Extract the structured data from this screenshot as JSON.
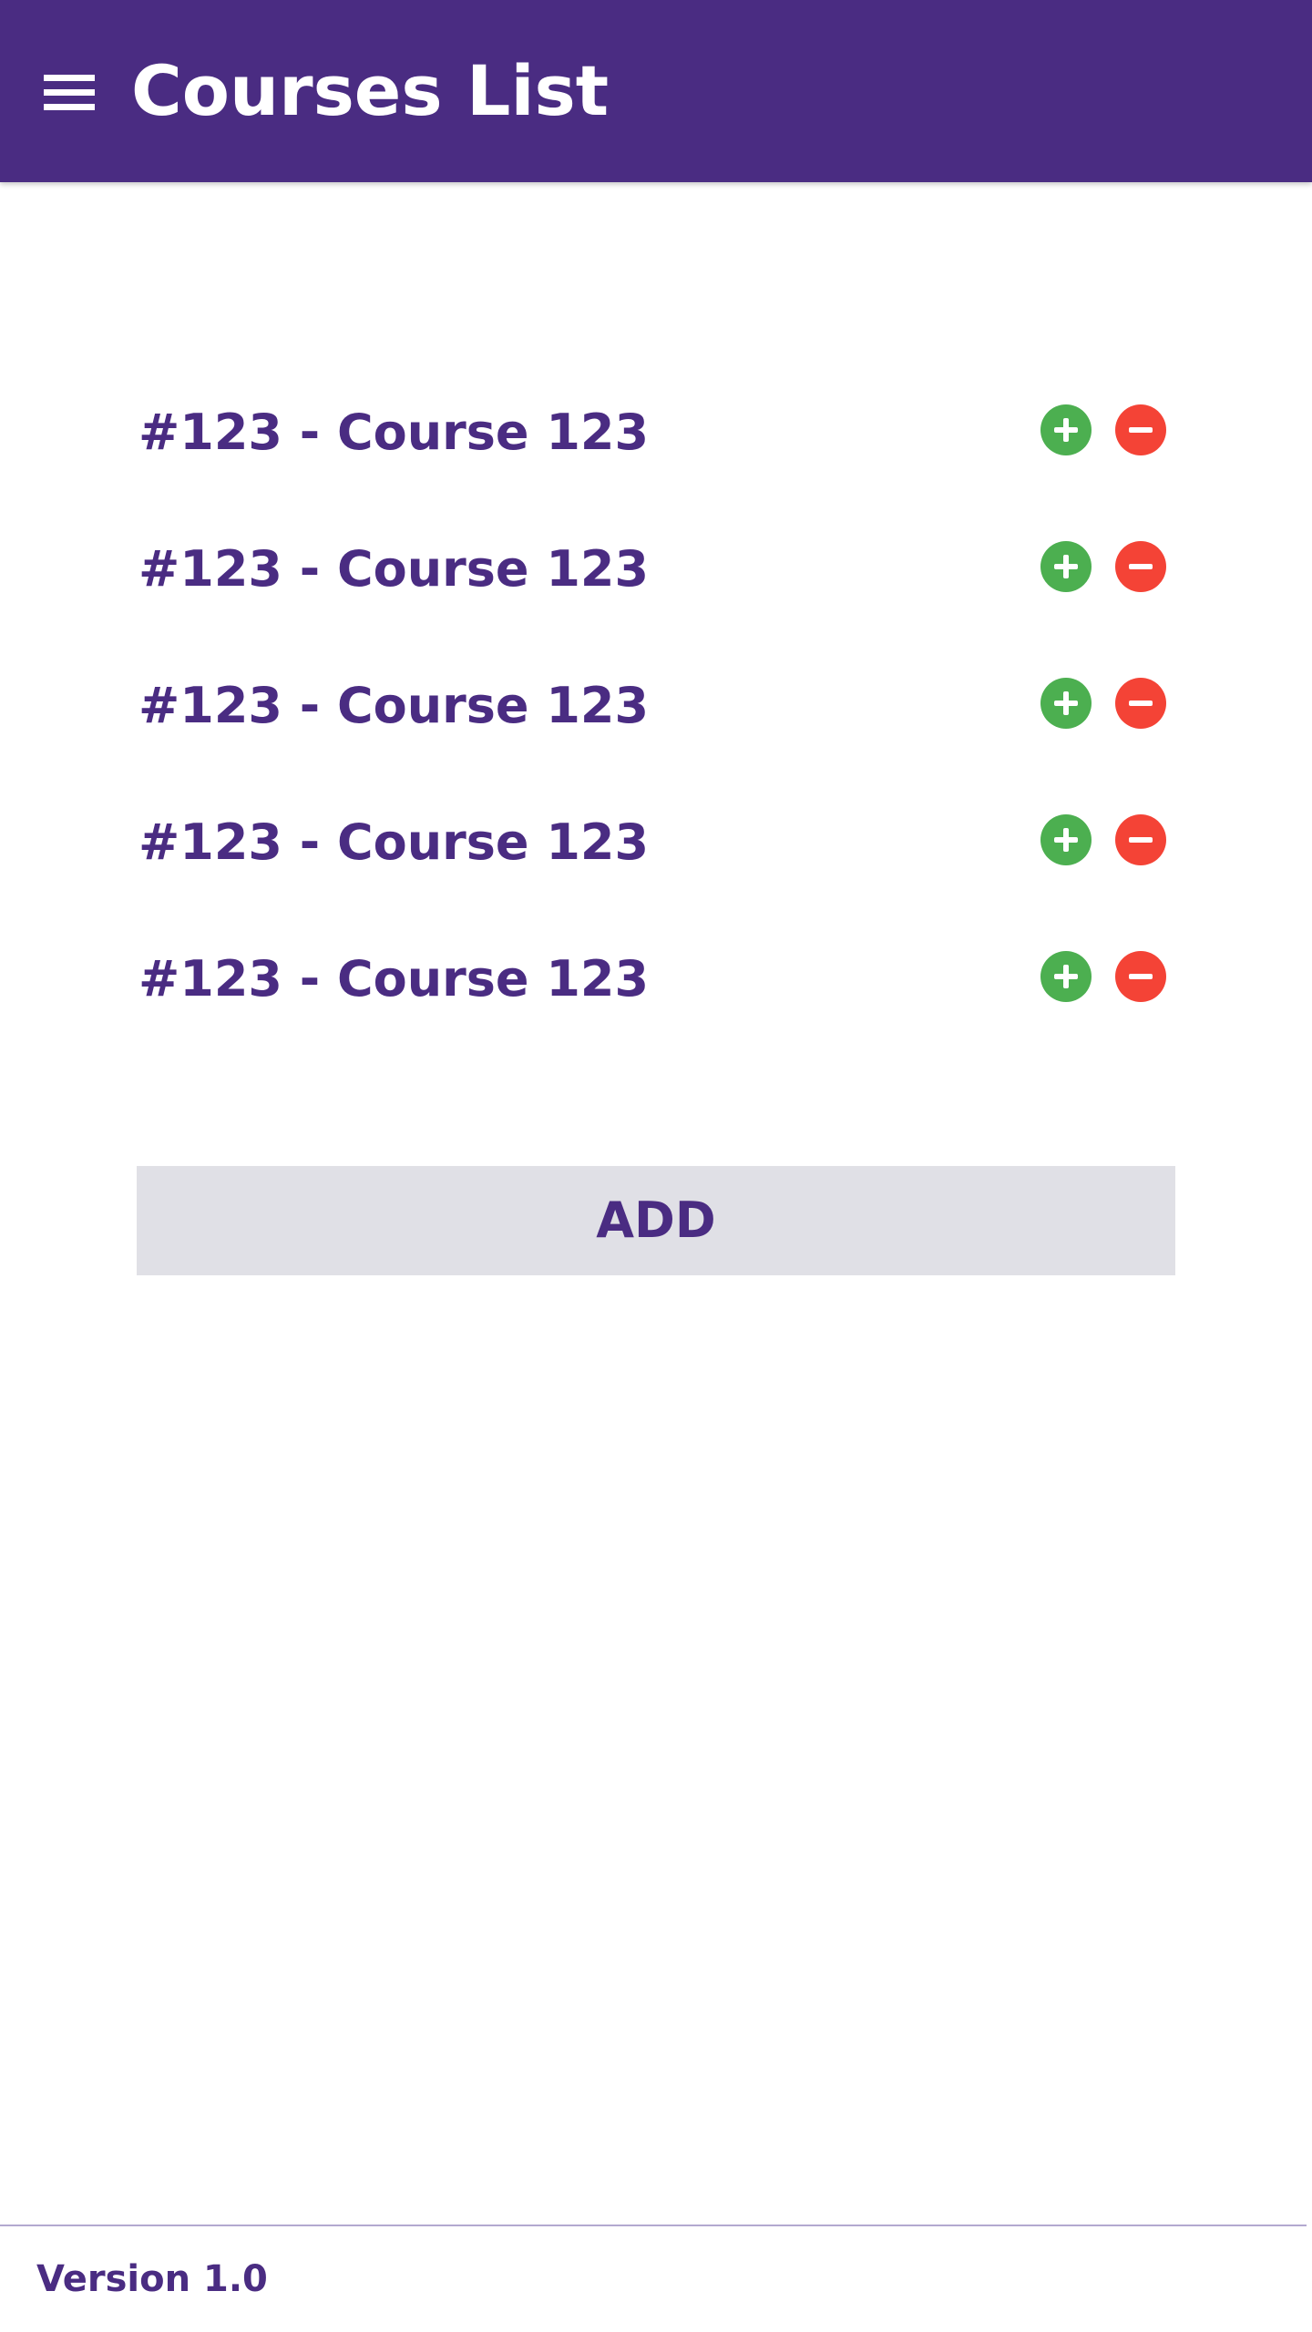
{
  "app_bar": {
    "menu_icon": "hamburger-menu-icon",
    "title": "Courses List",
    "background_color": "#4a2c82"
  },
  "courses": [
    {
      "label": "#123 - Course 123",
      "add_icon": "plus-circle-icon",
      "remove_icon": "minus-circle-icon"
    },
    {
      "label": "#123 - Course 123",
      "add_icon": "plus-circle-icon",
      "remove_icon": "minus-circle-icon"
    },
    {
      "label": "#123 - Course 123",
      "add_icon": "plus-circle-icon",
      "remove_icon": "minus-circle-icon"
    },
    {
      "label": "#123 - Course 123",
      "add_icon": "plus-circle-icon",
      "remove_icon": "minus-circle-icon"
    },
    {
      "label": "#123 - Course 123",
      "add_icon": "plus-circle-icon",
      "remove_icon": "minus-circle-icon"
    }
  ],
  "add_button": {
    "label": "ADD"
  },
  "footer": {
    "version": "Version 1.0"
  },
  "colors": {
    "accent": "#4a2c82",
    "add": "#4caf50",
    "remove": "#f44336",
    "button_bg": "#e0e0e6"
  }
}
